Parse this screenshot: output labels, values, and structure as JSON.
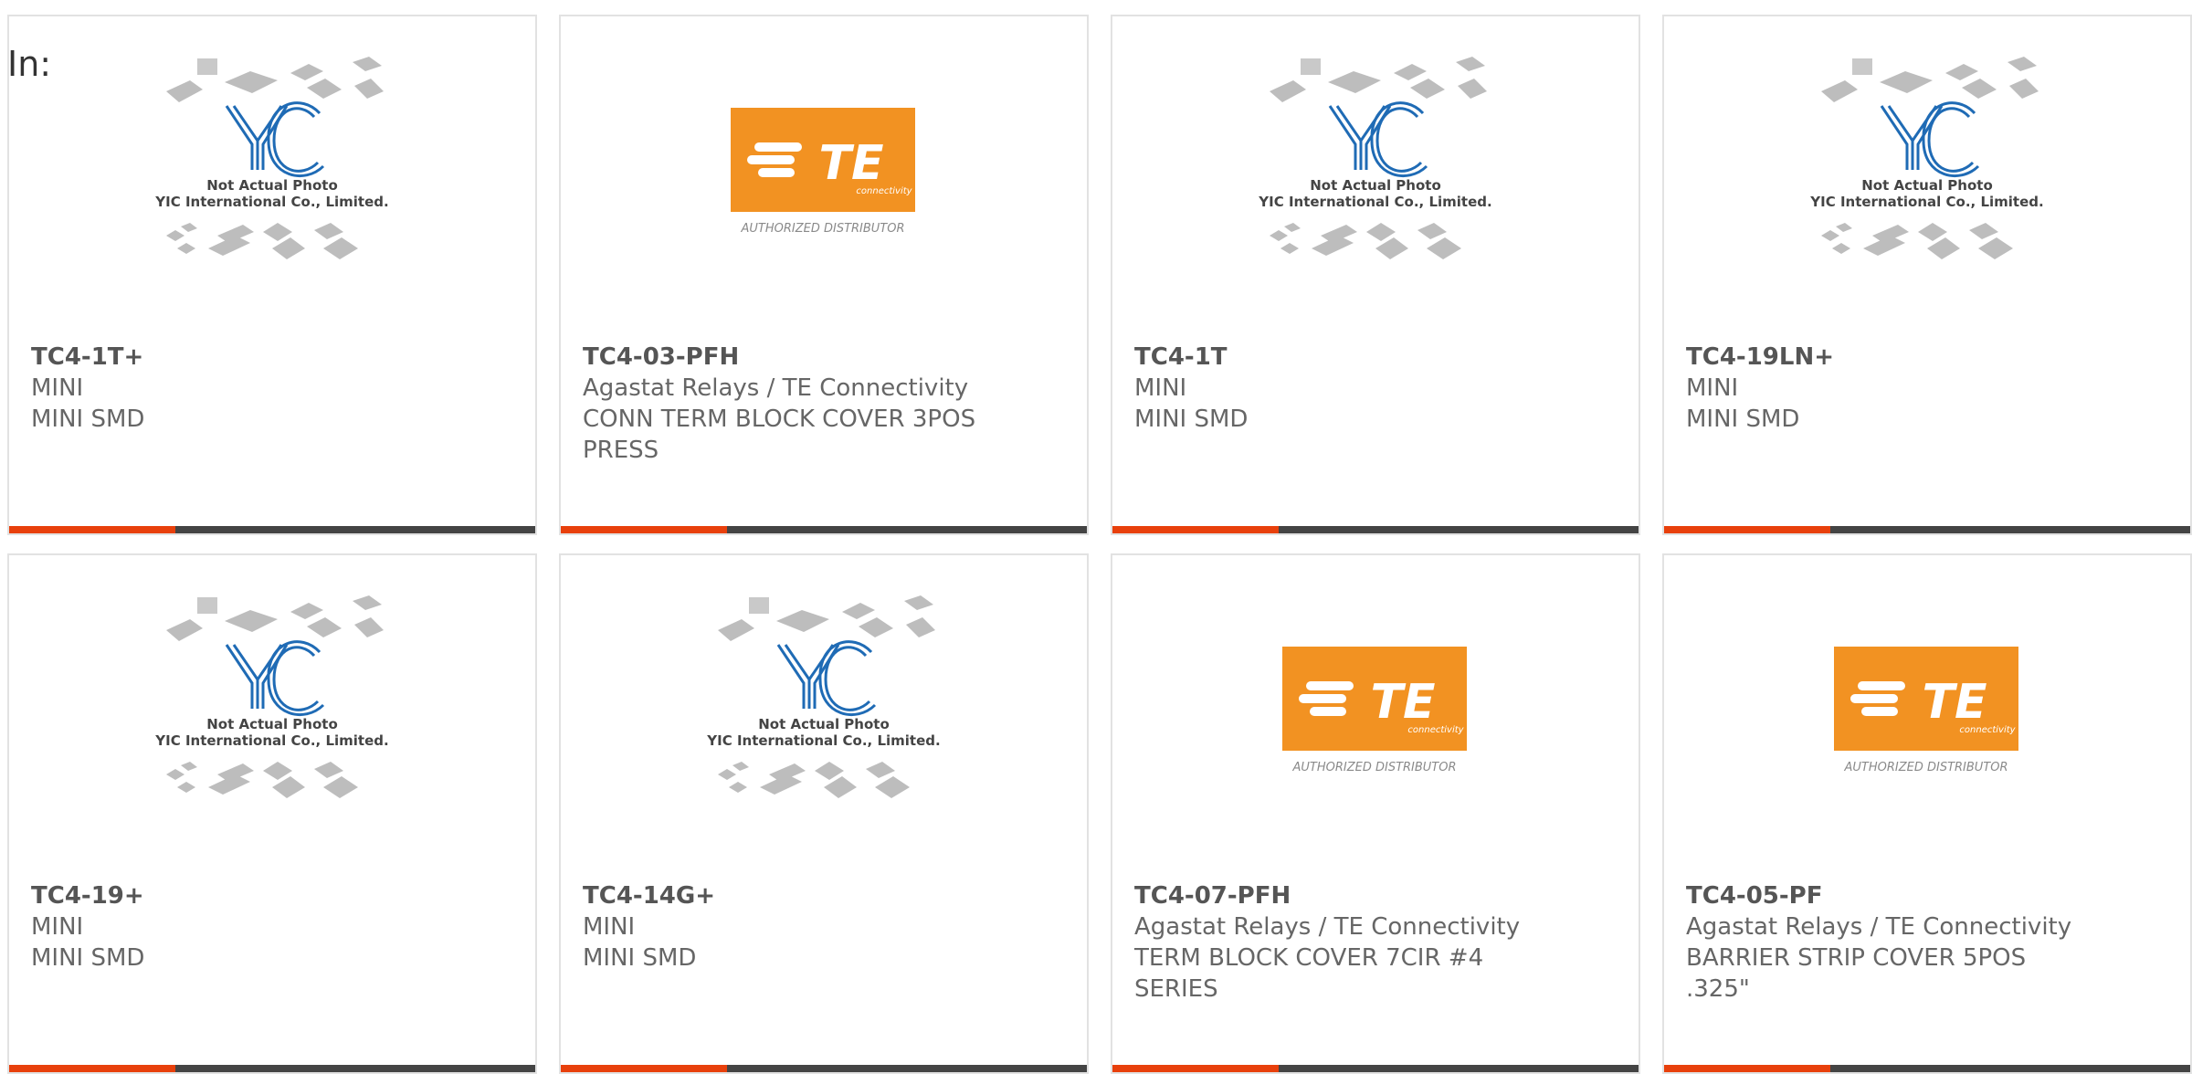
{
  "prefix_label": "In:",
  "placeholder_caption": {
    "line1": "Not Actual Photo",
    "line2": "YIC International Co., Limited."
  },
  "te_logo": {
    "text": "TE",
    "subtext": "connectivity",
    "caption": "AUTHORIZED DISTRIBUTOR"
  },
  "colors": {
    "accent": "#e8400c",
    "bar": "#444444",
    "te_orange": "#f29222",
    "yic_blue": "#1f6bb5"
  },
  "products": [
    {
      "image": "yic",
      "part": "TC4-1T+",
      "lines": [
        "MINI",
        "MINI SMD"
      ]
    },
    {
      "image": "te",
      "part": "TC4-03-PFH",
      "lines": [
        "Agastat Relays / TE Connectivity",
        "CONN TERM BLOCK COVER 3POS",
        "PRESS"
      ]
    },
    {
      "image": "yic",
      "part": "TC4-1T",
      "lines": [
        "MINI",
        "MINI SMD"
      ]
    },
    {
      "image": "yic",
      "part": "TC4-19LN+",
      "lines": [
        "MINI",
        "MINI SMD"
      ]
    },
    {
      "image": "yic",
      "part": "TC4-19+",
      "lines": [
        "MINI",
        "MINI SMD"
      ]
    },
    {
      "image": "yic",
      "part": "TC4-14G+",
      "lines": [
        "MINI",
        "MINI SMD"
      ]
    },
    {
      "image": "te",
      "part": "TC4-07-PFH",
      "lines": [
        "Agastat Relays / TE Connectivity",
        "TERM BLOCK COVER 7CIR #4",
        "SERIES"
      ]
    },
    {
      "image": "te",
      "part": "TC4-05-PF",
      "lines": [
        "Agastat Relays / TE Connectivity",
        "BARRIER STRIP COVER 5POS",
        ".325\""
      ]
    }
  ]
}
